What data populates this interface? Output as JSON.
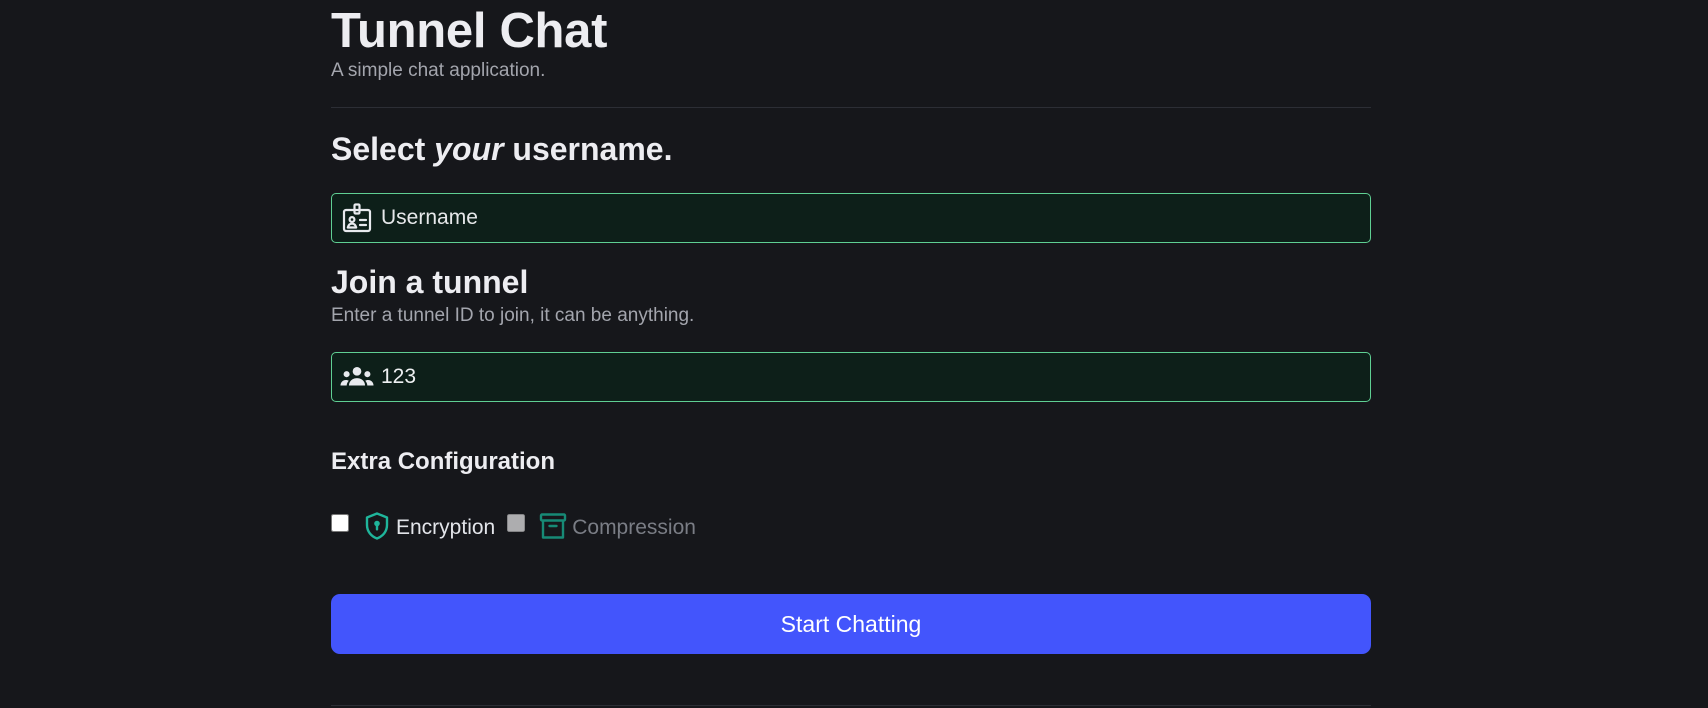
{
  "app": {
    "title": "Tunnel Chat",
    "subtitle": "A simple chat application."
  },
  "username_section": {
    "heading_before": "Select ",
    "heading_emphasis": "your",
    "heading_after": " username.",
    "input": {
      "value": "",
      "placeholder": "Username",
      "icon": "id-badge-icon"
    }
  },
  "tunnel_section": {
    "heading": "Join a tunnel",
    "description": "Enter a tunnel ID to join, it can be anything.",
    "input": {
      "value": "123",
      "placeholder": "",
      "icon": "users-group-icon"
    }
  },
  "extra_config": {
    "heading": "Extra Configuration",
    "options": [
      {
        "label": "Encryption",
        "checked": false,
        "icon": "shield-lock-icon",
        "enabled": true
      },
      {
        "label": "Compression",
        "checked": false,
        "icon": "archive-box-icon",
        "enabled": false
      }
    ]
  },
  "start_button": {
    "label": "Start Chatting"
  },
  "colors": {
    "background": "#16171b",
    "input_border": "#5fcf93",
    "input_background": "#0d1f19",
    "accent_icon": "#1fb59b",
    "primary_button": "#4355fc",
    "muted_text": "#a3a5ad"
  }
}
